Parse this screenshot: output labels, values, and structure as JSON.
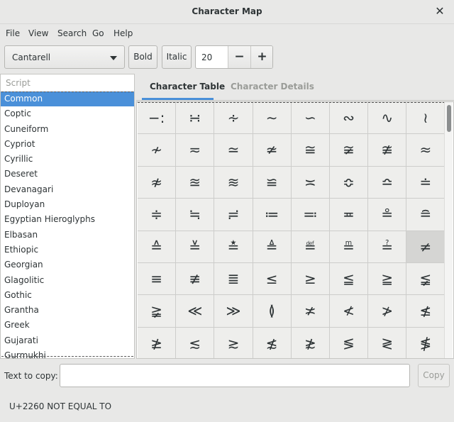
{
  "window": {
    "title": "Character Map"
  },
  "menu": [
    "File",
    "View",
    "Search",
    "Go",
    "Help"
  ],
  "toolbar": {
    "font": "Cantarell",
    "bold_label": "Bold",
    "italic_label": "Italic",
    "size": "20",
    "minus_label": "−",
    "plus_label": "+"
  },
  "sidebar": {
    "header": "Script",
    "items": [
      "Common",
      "Coptic",
      "Cuneiform",
      "Cypriot",
      "Cyrillic",
      "Deseret",
      "Devanagari",
      "Duployan",
      "Egyptian Hieroglyphs",
      "Elbasan",
      "Ethiopic",
      "Georgian",
      "Glagolitic",
      "Gothic",
      "Grantha",
      "Greek",
      "Gujarati",
      "Gurmukhi"
    ],
    "selected": "Common"
  },
  "tabs": {
    "table": "Character Table",
    "details": "Character Details"
  },
  "grid": {
    "chars": [
      "−:",
      "∺",
      "∻",
      "∼",
      "∽",
      "∾",
      "∿",
      "≀",
      "≁",
      "≂",
      "≃",
      "≄",
      "≅",
      "≆",
      "≇",
      "≈",
      "≉",
      "≊",
      "≋",
      "≌",
      "≍",
      "≎",
      "≏",
      "≐",
      "≑",
      "≒",
      "≓",
      "≔",
      "≕",
      "≖",
      "≗",
      "≘",
      "≙",
      "≚",
      "≛",
      "≜",
      "≝",
      "≞",
      "≟",
      "≠",
      "≡",
      "≢",
      "≣",
      "≤",
      "≥",
      "≦",
      "≧",
      "≨",
      "≩",
      "≪",
      "≫",
      "≬",
      "≭",
      "≮",
      "≯",
      "≰",
      "≱",
      "≲",
      "≳",
      "≴",
      "≵",
      "≶",
      "≷",
      "≸"
    ],
    "selected": "≠"
  },
  "copy": {
    "label": "Text to copy:",
    "value": "",
    "button": "Copy"
  },
  "status": "U+2260 NOT EQUAL TO",
  "colors": {
    "accent": "#4a90d9",
    "window_bg": "#e8e8e7",
    "cell_bg": "#eeeeec",
    "cell_selected": "#d5d5d3"
  }
}
